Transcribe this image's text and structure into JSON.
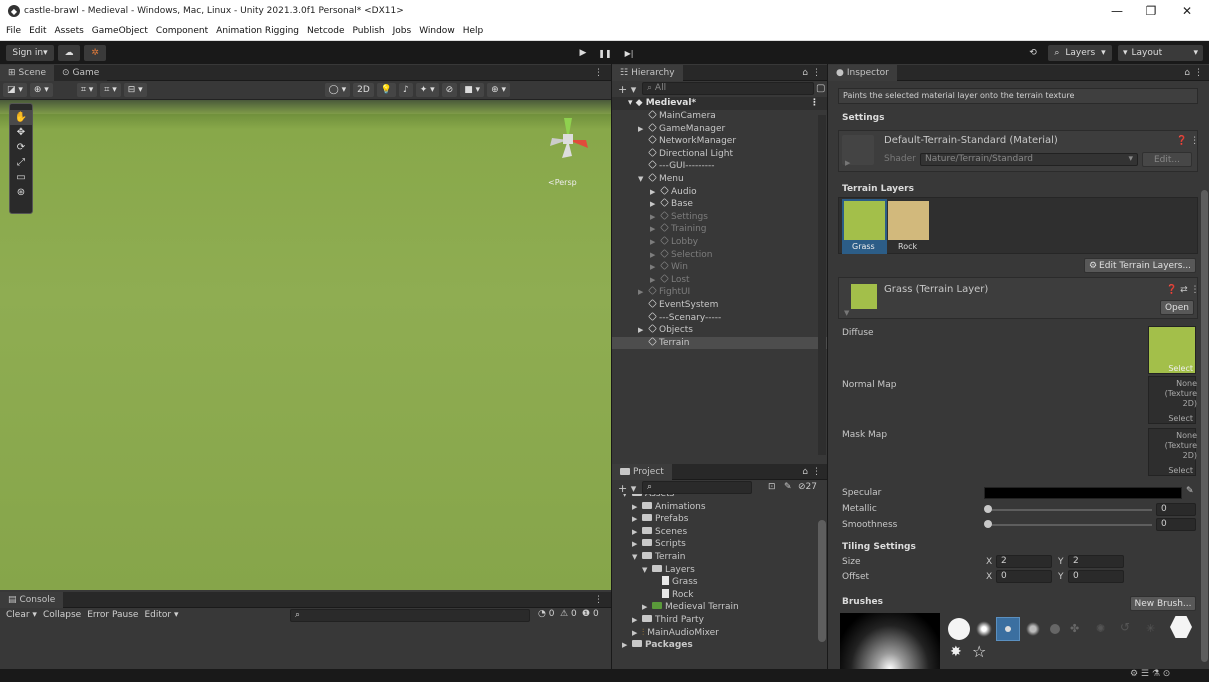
{
  "window": {
    "title": "castle-brawl - Medieval - Windows, Mac, Linux - Unity 2021.3.0f1 Personal* <DX11>",
    "minimize": "—",
    "restore": "❐",
    "close": "✕"
  },
  "menubar": [
    "File",
    "Edit",
    "Assets",
    "GameObject",
    "Component",
    "Animation Rigging",
    "Netcode",
    "Publish",
    "Jobs",
    "Window",
    "Help"
  ],
  "toolbar": {
    "sign_in": "Sign in",
    "cloud_icon": "cloud-icon",
    "collab_icon": "collab-icon",
    "play": "▶",
    "pause": "❚❚",
    "step": "▶|",
    "history_icon": "history-icon",
    "search_icon": "search-icon",
    "layers": "Layers",
    "layout": "Layout"
  },
  "scene": {
    "tab_scene": "Scene",
    "tab_game": "Game",
    "mode_2d": "2D",
    "persp": "<Persp",
    "tools": [
      "✋",
      "✥",
      "⟳",
      "⤢",
      "▭",
      "⊛"
    ]
  },
  "console": {
    "tab": "Console",
    "clear": "Clear",
    "collapse": "Collapse",
    "error_pause": "Error Pause",
    "editor": "Editor",
    "count_log": "0",
    "count_warn": "0",
    "count_err": "0"
  },
  "hierarchy": {
    "tab": "Hierarchy",
    "search_placeholder": "All",
    "scene_name": "Medieval*",
    "items": [
      {
        "label": "MainCamera",
        "indent": 1,
        "arrow": false,
        "dim": false
      },
      {
        "label": "GameManager",
        "indent": 1,
        "arrow": true,
        "dim": false
      },
      {
        "label": "NetworkManager",
        "indent": 1,
        "arrow": false,
        "dim": false
      },
      {
        "label": "Directional Light",
        "indent": 1,
        "arrow": false,
        "dim": false
      },
      {
        "label": "---GUI---------",
        "indent": 1,
        "arrow": false,
        "dim": false
      },
      {
        "label": "Menu",
        "indent": 1,
        "arrow": true,
        "open": true,
        "dim": false
      },
      {
        "label": "Audio",
        "indent": 2,
        "arrow": true,
        "dim": false
      },
      {
        "label": "Base",
        "indent": 2,
        "arrow": true,
        "dim": false
      },
      {
        "label": "Settings",
        "indent": 2,
        "arrow": true,
        "dim": true
      },
      {
        "label": "Training",
        "indent": 2,
        "arrow": true,
        "dim": true
      },
      {
        "label": "Lobby",
        "indent": 2,
        "arrow": true,
        "dim": true
      },
      {
        "label": "Selection",
        "indent": 2,
        "arrow": true,
        "dim": true
      },
      {
        "label": "Win",
        "indent": 2,
        "arrow": true,
        "dim": true
      },
      {
        "label": "Lost",
        "indent": 2,
        "arrow": true,
        "dim": true
      },
      {
        "label": "FightUI",
        "indent": 1,
        "arrow": true,
        "dim": true
      },
      {
        "label": "EventSystem",
        "indent": 1,
        "arrow": false,
        "dim": false
      },
      {
        "label": "---Scenary-----",
        "indent": 1,
        "arrow": false,
        "dim": false
      },
      {
        "label": "Objects",
        "indent": 1,
        "arrow": true,
        "dim": false
      },
      {
        "label": "Terrain",
        "indent": 1,
        "arrow": false,
        "dim": false,
        "selected": true
      }
    ]
  },
  "project": {
    "tab": "Project",
    "hidden_count": "27",
    "items": [
      {
        "label": "Assets",
        "indent": 0,
        "kind": "folder",
        "open": true
      },
      {
        "label": "Animations",
        "indent": 1,
        "kind": "folder"
      },
      {
        "label": "Prefabs",
        "indent": 1,
        "kind": "folder"
      },
      {
        "label": "Scenes",
        "indent": 1,
        "kind": "folder"
      },
      {
        "label": "Scripts",
        "indent": 1,
        "kind": "folder"
      },
      {
        "label": "Terrain",
        "indent": 1,
        "kind": "folder",
        "open": true
      },
      {
        "label": "Layers",
        "indent": 2,
        "kind": "folder",
        "open": true
      },
      {
        "label": "Grass",
        "indent": 3,
        "kind": "file"
      },
      {
        "label": "Rock",
        "indent": 3,
        "kind": "file"
      },
      {
        "label": "Medieval Terrain",
        "indent": 2,
        "kind": "terrain"
      },
      {
        "label": "Third Party",
        "indent": 1,
        "kind": "folder"
      },
      {
        "label": "MainAudioMixer",
        "indent": 1,
        "kind": "mixer"
      },
      {
        "label": "Packages",
        "indent": 0,
        "kind": "folder",
        "bold": true
      }
    ]
  },
  "inspector": {
    "tab": "Inspector",
    "hint": "Paints the selected material layer onto the terrain texture",
    "settings": "Settings",
    "material": "Default-Terrain-Standard (Material)",
    "shader_label": "Shader",
    "shader_value": "Nature/Terrain/Standard",
    "edit": "Edit...",
    "terrain_layers": "Terrain Layers",
    "layer_grass": "Grass",
    "layer_rock": "Rock",
    "edit_terrain_layers": "Edit Terrain Layers...",
    "grass_layer_title": "Grass (Terrain Layer)",
    "open": "Open",
    "diffuse": "Diffuse",
    "normal_map": "Normal Map",
    "mask_map": "Mask Map",
    "select": "Select",
    "none_tex": "None (Texture 2D)",
    "specular": "Specular",
    "metallic": "Metallic",
    "metallic_value": "0",
    "smoothness": "Smoothness",
    "smoothness_value": "0",
    "tiling_settings": "Tiling Settings",
    "size": "Size",
    "offset": "Offset",
    "x_label": "X",
    "y_label": "Y",
    "size_x": "2",
    "size_y": "2",
    "offset_x": "0",
    "offset_y": "0",
    "brushes": "Brushes",
    "new_brush": "New Brush..."
  },
  "colors": {
    "grass": "#a3bf4a",
    "rock": "#d2b97c",
    "selection_blue": "#2c5d87"
  }
}
